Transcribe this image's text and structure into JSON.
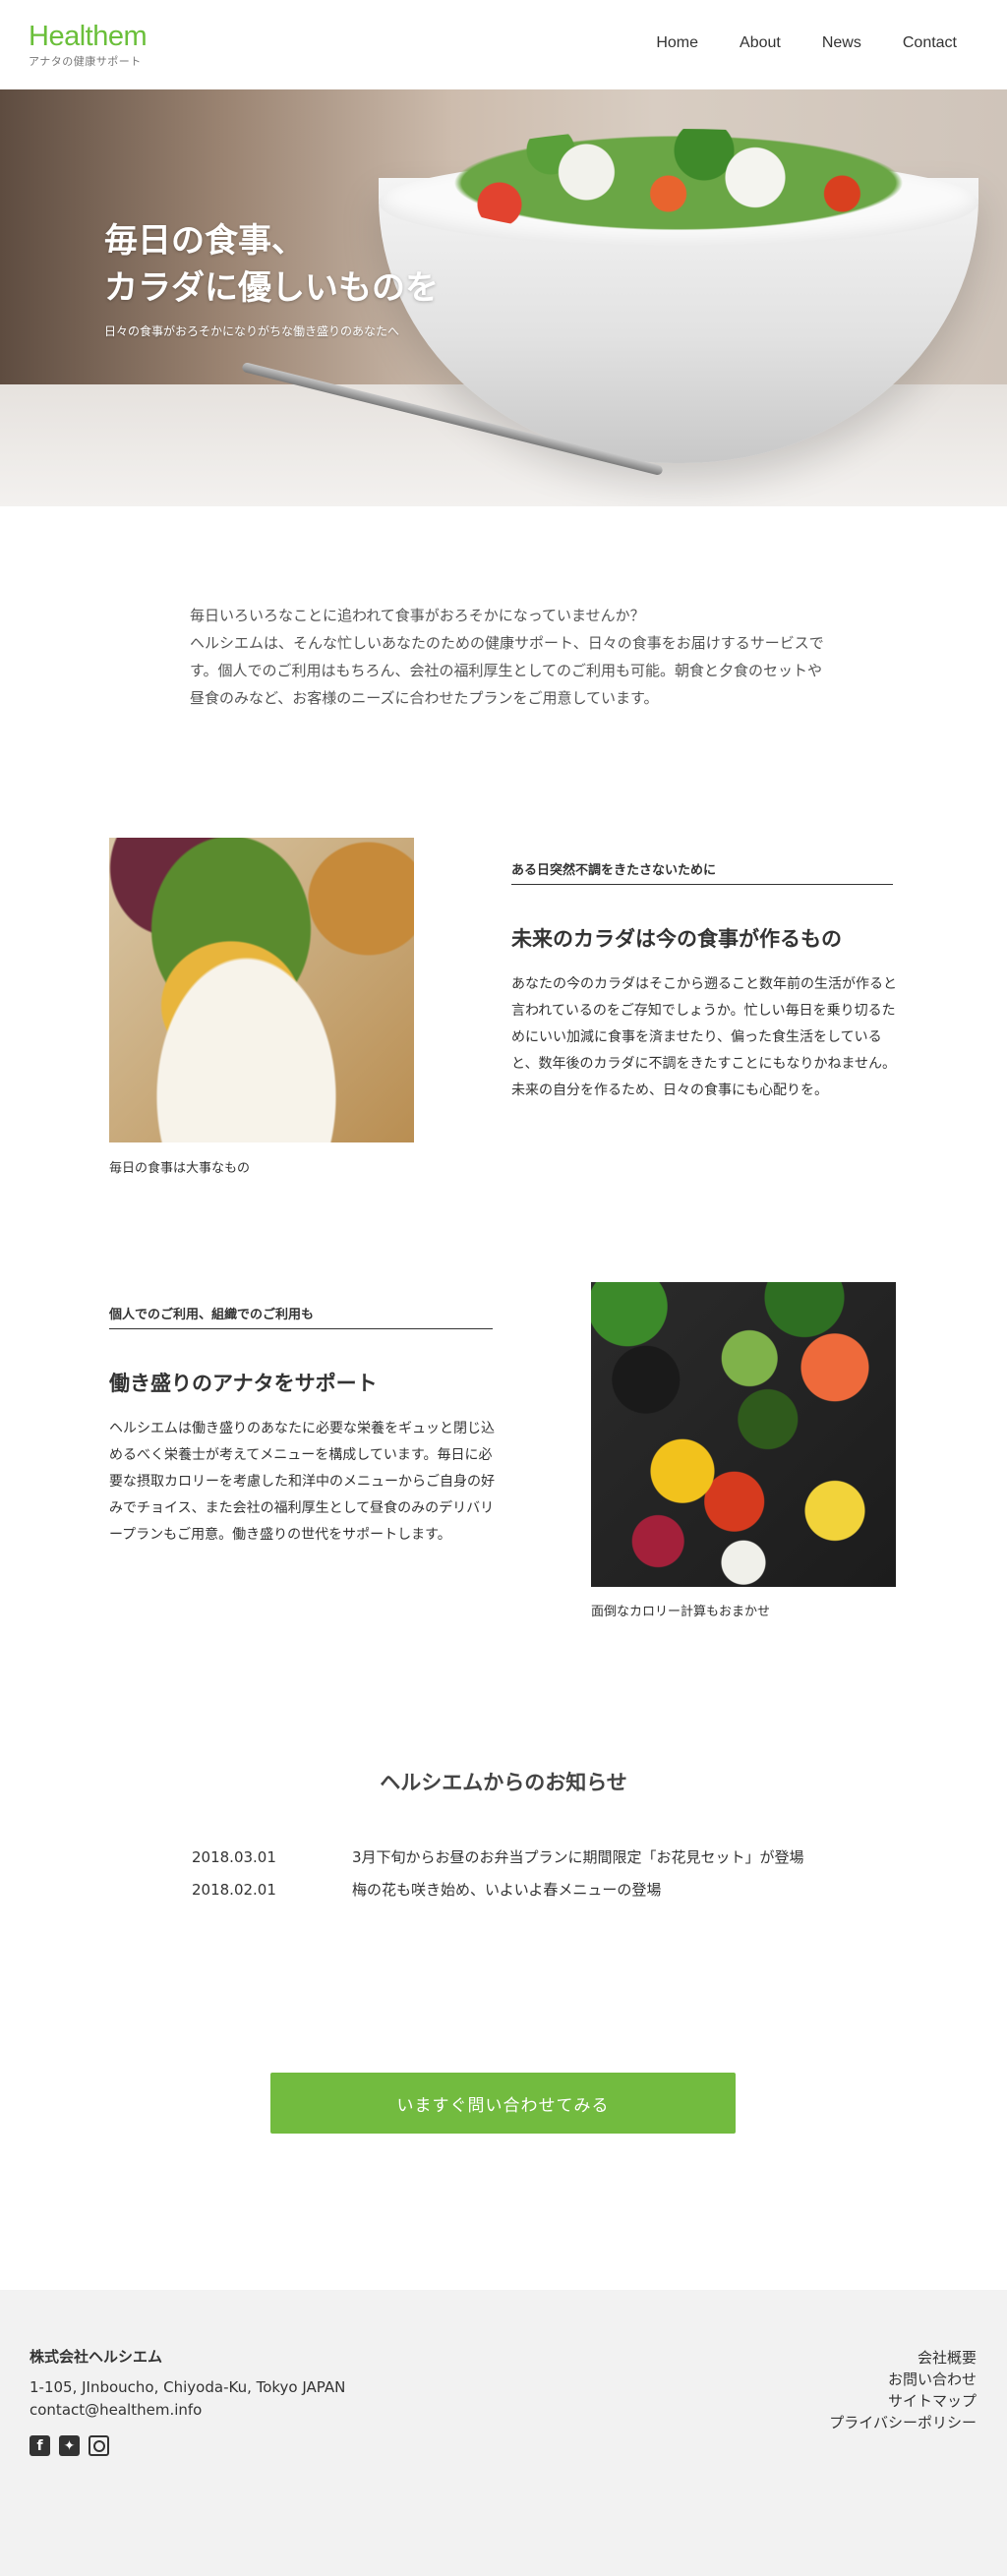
{
  "header": {
    "logo_name": "Healthem",
    "logo_tagline": "アナタの健康サポート",
    "nav": [
      "Home",
      "About",
      "News",
      "Contact"
    ]
  },
  "hero": {
    "title": "毎日の食事、\nカラダに優しいものを",
    "subtitle": "日々の食事がおろそかになりがちな働き盛りのあなたへ"
  },
  "intro": {
    "text": "毎日いろいろなことに追われて食事がおろそかになっていませんか？\nヘルシエムは、そんな忙しいあなたのための健康サポート、日々の食事をお届けするサービスです。個人でのご利用はもちろん、会社の福利厚生としてのご利用も可能。朝食と夕食のセットや昼食のみなど、お客様のニーズに合わせたプランをご用意しています。"
  },
  "features": [
    {
      "label": "ある日突然不調をきたさないために",
      "heading": "未来のカラダは今の食事が作るもの",
      "body": "あなたの今のカラダはそこから遡ること数年前の生活が作ると言われているのをご存知でしょうか。忙しい毎日を乗り切るためにいい加減に食事を済ませたり、偏った食生活をしていると、数年後のカラダに不調をきたすことにもなりかねません。未来の自分を作るため、日々の食事にも心配りを。",
      "caption": "毎日の食事は大事なもの"
    },
    {
      "label": "個人でのご利用、組織でのご利用も",
      "heading": "働き盛りのアナタをサポート",
      "body": "ヘルシエムは働き盛りのあなたに必要な栄養をギュッと閉じ込めるべく栄養士が考えてメニューを構成しています。毎日に必要な摂取カロリーを考慮した和洋中のメニューからご自身の好みでチョイス、また会社の福利厚生として昼食のみのデリバリープランもご用意。働き盛りの世代をサポートします。",
      "caption": "面倒なカロリー計算もおまかせ"
    }
  ],
  "news": {
    "title": "ヘルシエムからのお知らせ",
    "items": [
      {
        "date": "2018.03.01",
        "text": "3月下旬からお昼のお弁当プランに期間限定「お花見セット」が登場"
      },
      {
        "date": "2018.02.01",
        "text": "梅の花も咲き始め、いよいよ春メニューの登場"
      }
    ]
  },
  "cta": {
    "label": "いますぐ問い合わせてみる"
  },
  "footer": {
    "company": "株式会社ヘルシエム",
    "address": "1-105, JInboucho, Chiyoda-Ku, Tokyo JAPAN",
    "email": "contact@healthem.info",
    "social_icons": [
      "facebook-icon",
      "twitter-icon",
      "instagram-icon"
    ],
    "links": [
      "会社概要",
      "お問い合わせ",
      "サイトマップ",
      "プライバシーポリシー"
    ]
  },
  "colors": {
    "brand_green": "#6abf3a",
    "cta_green": "#72bb3f",
    "footer_bg": "#f2f2f2"
  }
}
